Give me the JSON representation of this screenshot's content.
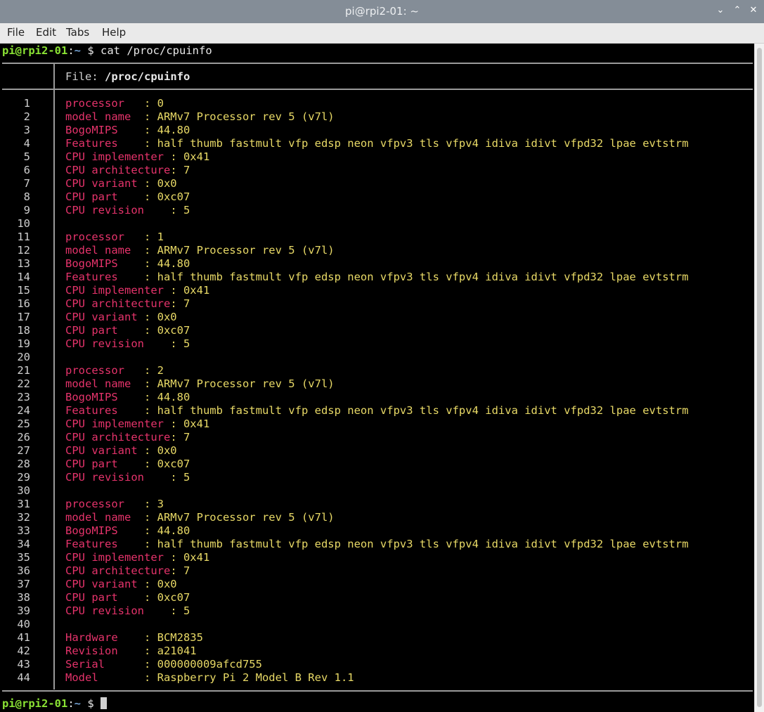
{
  "window": {
    "title": "pi@rpi2-01: ~",
    "controls": [
      "chevron-down-icon",
      "chevron-up-icon",
      "close-icon"
    ]
  },
  "menu": [
    "File",
    "Edit",
    "Tabs",
    "Help"
  ],
  "terminal": {
    "prompt_user": "pi@rpi2-01",
    "prompt_sep": ":",
    "prompt_path": "~",
    "prompt_symbol": " $ ",
    "command": "cat /proc/cpuinfo",
    "file_label": "File: ",
    "file_path": "/proc/cpuinfo",
    "lines": [
      {
        "n": "1",
        "k": "processor   ",
        "v": ": 0"
      },
      {
        "n": "2",
        "k": "model name  ",
        "v": ": ARMv7 Processor rev 5 (v7l)"
      },
      {
        "n": "3",
        "k": "BogoMIPS    ",
        "v": ": 44.80"
      },
      {
        "n": "4",
        "k": "Features    ",
        "v": ": half thumb fastmult vfp edsp neon vfpv3 tls vfpv4 idiva idivt vfpd32 lpae evtstrm"
      },
      {
        "n": "5",
        "k": "CPU implementer ",
        "v": ": 0x41"
      },
      {
        "n": "6",
        "k": "CPU architecture",
        "v": ": 7"
      },
      {
        "n": "7",
        "k": "CPU variant ",
        "v": ": 0x0"
      },
      {
        "n": "8",
        "k": "CPU part    ",
        "v": ": 0xc07"
      },
      {
        "n": "9",
        "k": "CPU revision    ",
        "v": ": 5"
      },
      {
        "n": "10",
        "k": "",
        "v": ""
      },
      {
        "n": "11",
        "k": "processor   ",
        "v": ": 1"
      },
      {
        "n": "12",
        "k": "model name  ",
        "v": ": ARMv7 Processor rev 5 (v7l)"
      },
      {
        "n": "13",
        "k": "BogoMIPS    ",
        "v": ": 44.80"
      },
      {
        "n": "14",
        "k": "Features    ",
        "v": ": half thumb fastmult vfp edsp neon vfpv3 tls vfpv4 idiva idivt vfpd32 lpae evtstrm"
      },
      {
        "n": "15",
        "k": "CPU implementer ",
        "v": ": 0x41"
      },
      {
        "n": "16",
        "k": "CPU architecture",
        "v": ": 7"
      },
      {
        "n": "17",
        "k": "CPU variant ",
        "v": ": 0x0"
      },
      {
        "n": "18",
        "k": "CPU part    ",
        "v": ": 0xc07"
      },
      {
        "n": "19",
        "k": "CPU revision    ",
        "v": ": 5"
      },
      {
        "n": "20",
        "k": "",
        "v": ""
      },
      {
        "n": "21",
        "k": "processor   ",
        "v": ": 2"
      },
      {
        "n": "22",
        "k": "model name  ",
        "v": ": ARMv7 Processor rev 5 (v7l)"
      },
      {
        "n": "23",
        "k": "BogoMIPS    ",
        "v": ": 44.80"
      },
      {
        "n": "24",
        "k": "Features    ",
        "v": ": half thumb fastmult vfp edsp neon vfpv3 tls vfpv4 idiva idivt vfpd32 lpae evtstrm"
      },
      {
        "n": "25",
        "k": "CPU implementer ",
        "v": ": 0x41"
      },
      {
        "n": "26",
        "k": "CPU architecture",
        "v": ": 7"
      },
      {
        "n": "27",
        "k": "CPU variant ",
        "v": ": 0x0"
      },
      {
        "n": "28",
        "k": "CPU part    ",
        "v": ": 0xc07"
      },
      {
        "n": "29",
        "k": "CPU revision    ",
        "v": ": 5"
      },
      {
        "n": "30",
        "k": "",
        "v": ""
      },
      {
        "n": "31",
        "k": "processor   ",
        "v": ": 3"
      },
      {
        "n": "32",
        "k": "model name  ",
        "v": ": ARMv7 Processor rev 5 (v7l)"
      },
      {
        "n": "33",
        "k": "BogoMIPS    ",
        "v": ": 44.80"
      },
      {
        "n": "34",
        "k": "Features    ",
        "v": ": half thumb fastmult vfp edsp neon vfpv3 tls vfpv4 idiva idivt vfpd32 lpae evtstrm"
      },
      {
        "n": "35",
        "k": "CPU implementer ",
        "v": ": 0x41"
      },
      {
        "n": "36",
        "k": "CPU architecture",
        "v": ": 7"
      },
      {
        "n": "37",
        "k": "CPU variant ",
        "v": ": 0x0"
      },
      {
        "n": "38",
        "k": "CPU part    ",
        "v": ": 0xc07"
      },
      {
        "n": "39",
        "k": "CPU revision    ",
        "v": ": 5"
      },
      {
        "n": "40",
        "k": "",
        "v": ""
      },
      {
        "n": "41",
        "k": "Hardware    ",
        "v": ": BCM2835"
      },
      {
        "n": "42",
        "k": "Revision    ",
        "v": ": a21041"
      },
      {
        "n": "43",
        "k": "Serial      ",
        "v": ": 000000009afcd755"
      },
      {
        "n": "44",
        "k": "Model       ",
        "v": ": Raspberry Pi 2 Model B Rev 1.1"
      }
    ]
  },
  "colors": {
    "key": "#e5336b",
    "value": "#e8d966",
    "prompt_user": "#8ae234",
    "prompt_path": "#729fcf",
    "background": "#000000"
  }
}
